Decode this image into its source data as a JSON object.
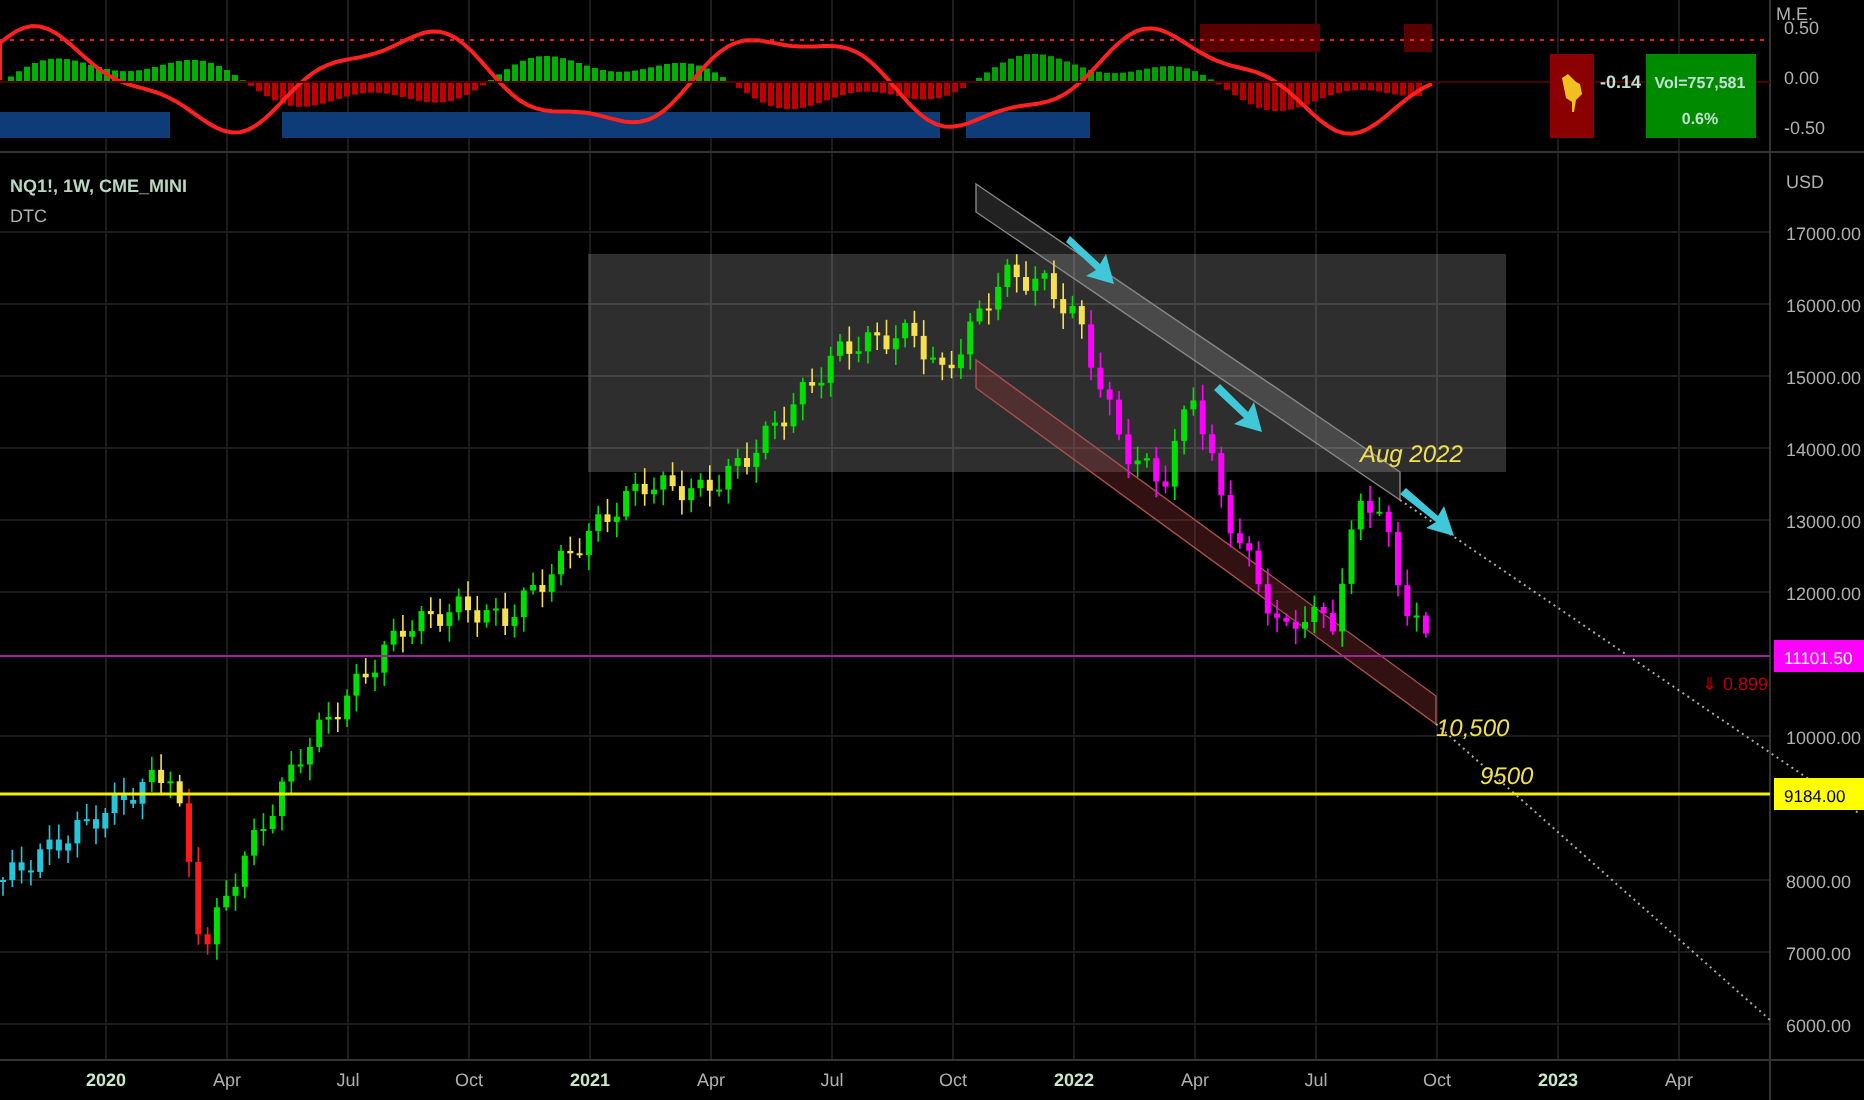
{
  "indicator": {
    "title": "M.E.",
    "axis_labels": [
      "0.50",
      "0.00",
      "-0.50"
    ],
    "value": "-0.14",
    "volume": "Vol=757,581",
    "change": "0.6%"
  },
  "chart": {
    "symbol": "NQ1!, 1W, CME_MINI",
    "study": "DTC",
    "currency": "USD",
    "price_ticks": [
      "17000.00",
      "16000.00",
      "15000.00",
      "14000.00",
      "13000.00",
      "12000.00",
      "10000.00",
      "8000.00",
      "7000.00",
      "6000.00"
    ],
    "time_ticks": [
      {
        "label": "2020",
        "kind": "year"
      },
      {
        "label": "Apr",
        "kind": "month"
      },
      {
        "label": "Jul",
        "kind": "month"
      },
      {
        "label": "Oct",
        "kind": "month"
      },
      {
        "label": "2021",
        "kind": "year"
      },
      {
        "label": "Apr",
        "kind": "month"
      },
      {
        "label": "Jul",
        "kind": "month"
      },
      {
        "label": "Oct",
        "kind": "month"
      },
      {
        "label": "2022",
        "kind": "year"
      },
      {
        "label": "Apr",
        "kind": "month"
      },
      {
        "label": "Jul",
        "kind": "month"
      },
      {
        "label": "Oct",
        "kind": "month"
      },
      {
        "label": "2023",
        "kind": "year"
      },
      {
        "label": "Apr",
        "kind": "month"
      }
    ],
    "last_price": "11101.50",
    "level_price": "9184.00",
    "change_label": "⇓ 0.899",
    "annotations": [
      "Aug 2022",
      "10,500",
      "9500"
    ]
  }
}
